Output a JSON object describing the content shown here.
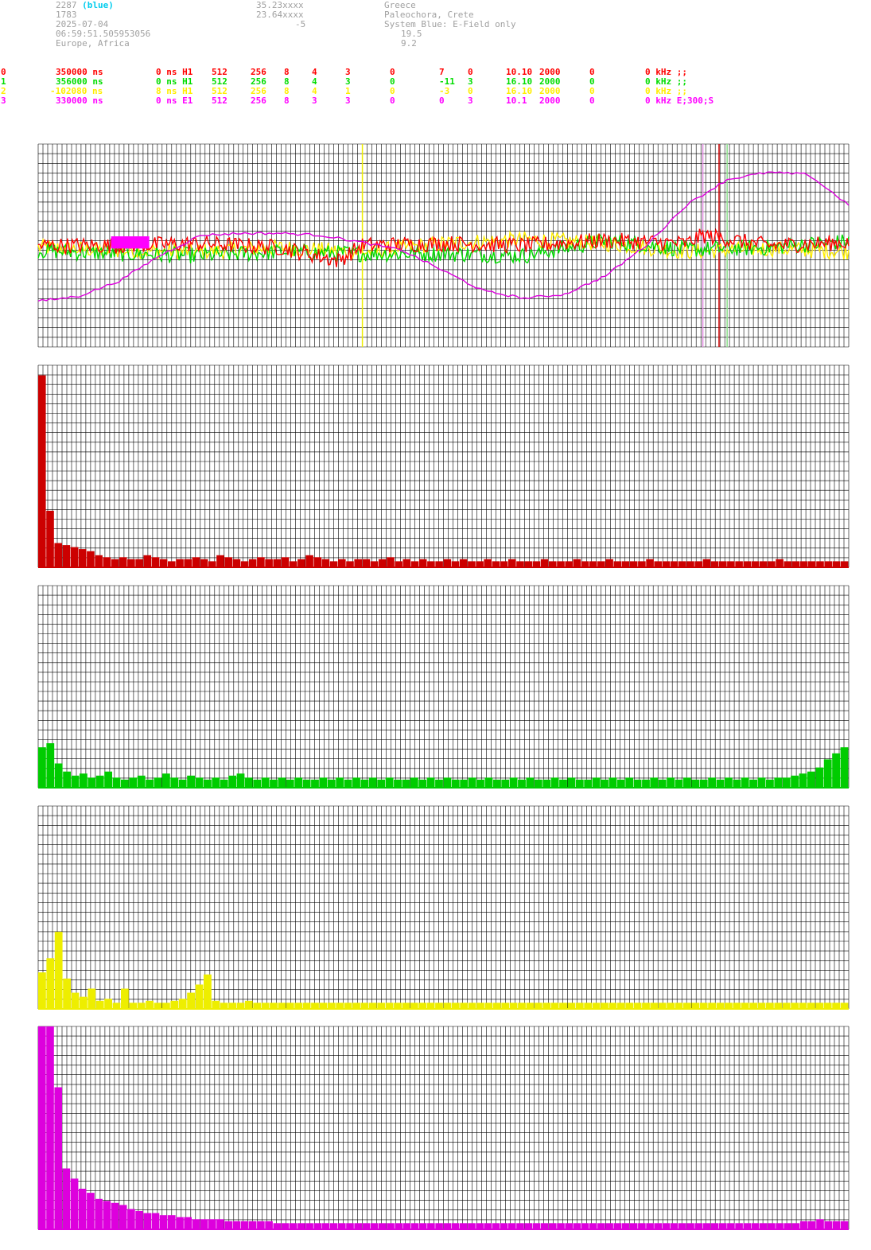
{
  "header": {
    "col1": [
      "2287",
      "1783",
      "2025-07-04",
      "06:59:51.505953056",
      "Europe, Africa"
    ],
    "col1_tag": "(blue)",
    "col2": [
      "35.23xxxx",
      "23.64xxxx",
      "-5"
    ],
    "col3": [
      "Greece",
      "Paleochora, Crete",
      "System Blue: E-Field only",
      "19.5",
      "9.2"
    ]
  },
  "channels": [
    {
      "id": "0",
      "color": "#ff0000",
      "cells": [
        "350000 ns",
        "0 ns H1",
        "512",
        "256",
        "8",
        "4",
        "3",
        "0",
        "7",
        "0",
        "10.10",
        "2000",
        "0",
        "0 kHz ;;"
      ]
    },
    {
      "id": "1",
      "color": "#00dd00",
      "cells": [
        "356000 ns",
        "0 ns H1",
        "512",
        "256",
        "8",
        "4",
        "3",
        "0",
        "-11",
        "3",
        "16.10",
        "2000",
        "0",
        "0 kHz ;;"
      ]
    },
    {
      "id": "2",
      "color": "#ffee00",
      "cells": [
        "-102080 ns",
        "8 ns H1",
        "512",
        "256",
        "8",
        "4",
        "1",
        "0",
        "-3",
        "0",
        "16.10",
        "2000",
        "0",
        "0 kHz ;;"
      ]
    },
    {
      "id": "3",
      "color": "#ff00ff",
      "cells": [
        "330000 ns",
        "0 ns E1",
        "512",
        "256",
        "8",
        "3",
        "3",
        "0",
        "0",
        "3",
        "10.1",
        "2000",
        "0",
        "0 kHz E;300;S"
      ]
    }
  ],
  "colors": {
    "grid": "#000000",
    "bg": "#ffffff",
    "red": "#cc0000",
    "green": "#00cc00",
    "yellow": "#eeee00",
    "magenta": "#dd00dd"
  },
  "chart_data": [
    {
      "type": "line",
      "panel": "waveform",
      "series": [
        {
          "color": "#dd00dd",
          "x": [
            0,
            5,
            10,
            15,
            20,
            25,
            30,
            35,
            40,
            45,
            50,
            55,
            60,
            65,
            70,
            75,
            80,
            85,
            90,
            95,
            100
          ],
          "y": [
            -5.5,
            -5.0,
            -3.5,
            -1.0,
            1.0,
            1.2,
            1.2,
            1.0,
            0.3,
            -0.5,
            -2.5,
            -4.5,
            -5.2,
            -4.8,
            -3.0,
            0.0,
            4.0,
            6.5,
            7.2,
            7.0,
            4.0
          ]
        },
        {
          "color": "#ff0000",
          "x": [
            0,
            10,
            20,
            30,
            37,
            40,
            50,
            60,
            70,
            80,
            82,
            90,
            100
          ],
          "y": [
            0,
            0,
            0.2,
            -0.2,
            -1.5,
            0,
            0.2,
            0,
            0.5,
            0.2,
            1.0,
            0,
            0.3
          ]
        },
        {
          "color": "#00dd00",
          "x": [
            0,
            10,
            20,
            30,
            40,
            50,
            60,
            70,
            80,
            90,
            100
          ],
          "y": [
            -0.5,
            -0.8,
            -1.0,
            -0.6,
            -0.8,
            -0.8,
            -1.0,
            0.5,
            -0.4,
            -0.2,
            0.4
          ]
        },
        {
          "color": "#ffee00",
          "x": [
            0,
            10,
            20,
            30,
            40,
            50,
            60,
            70,
            80,
            90,
            100
          ],
          "y": [
            -0.2,
            -0.5,
            -0.6,
            -0.2,
            -0.7,
            0.2,
            0.6,
            0.2,
            -0.6,
            -0.3,
            -0.6
          ]
        }
      ],
      "ylim": [
        -10,
        10
      ],
      "markers": [
        {
          "x": 40,
          "color": "#eeee00"
        },
        {
          "x": 82,
          "color": "#dd88dd"
        },
        {
          "x": 84,
          "color": "#cc0000"
        },
        {
          "x": 85,
          "color": "#88dd88"
        }
      ],
      "grid": true
    },
    {
      "type": "bar",
      "panel": "spectrum-0",
      "color": "#cc0000",
      "ylim": [
        0,
        100
      ],
      "values": [
        95,
        28,
        12,
        11,
        10,
        9,
        8,
        6,
        5,
        4,
        5,
        4,
        4,
        6,
        5,
        4,
        3,
        4,
        4,
        5,
        4,
        3,
        6,
        5,
        4,
        3,
        4,
        5,
        4,
        4,
        5,
        3,
        4,
        6,
        5,
        4,
        3,
        4,
        3,
        4,
        4,
        3,
        4,
        5,
        3,
        4,
        3,
        4,
        3,
        3,
        4,
        3,
        4,
        3,
        3,
        4,
        3,
        3,
        4,
        3,
        3,
        3,
        4,
        3,
        3,
        3,
        4,
        3,
        3,
        3,
        4,
        3,
        3,
        3,
        3,
        4,
        3,
        3,
        3,
        3,
        3,
        3,
        4,
        3,
        3,
        3,
        3,
        3,
        3,
        3,
        3,
        4,
        3,
        3,
        3,
        3,
        3,
        3,
        3,
        3
      ]
    },
    {
      "type": "bar",
      "panel": "spectrum-1",
      "color": "#00cc00",
      "ylim": [
        0,
        100
      ],
      "values": [
        20,
        22,
        12,
        8,
        6,
        7,
        5,
        6,
        8,
        5,
        4,
        5,
        6,
        4,
        5,
        7,
        5,
        4,
        6,
        5,
        4,
        5,
        4,
        6,
        7,
        5,
        4,
        5,
        4,
        5,
        4,
        5,
        4,
        4,
        5,
        4,
        5,
        4,
        5,
        4,
        5,
        4,
        5,
        4,
        4,
        5,
        4,
        5,
        4,
        5,
        4,
        4,
        5,
        4,
        5,
        4,
        4,
        5,
        4,
        5,
        4,
        4,
        5,
        4,
        5,
        4,
        4,
        5,
        4,
        5,
        4,
        5,
        4,
        4,
        5,
        4,
        5,
        4,
        5,
        4,
        4,
        5,
        4,
        5,
        4,
        5,
        4,
        5,
        4,
        5,
        5,
        6,
        7,
        8,
        10,
        14,
        17,
        20
      ]
    },
    {
      "type": "bar",
      "panel": "spectrum-2",
      "color": "#eeee00",
      "ylim": [
        0,
        100
      ],
      "values": [
        18,
        25,
        38,
        15,
        8,
        6,
        10,
        4,
        5,
        3,
        10,
        3,
        3,
        4,
        3,
        3,
        4,
        5,
        8,
        12,
        17,
        4,
        3,
        3,
        3,
        4,
        3,
        3,
        3,
        3,
        3,
        3,
        3,
        3,
        3,
        3,
        3,
        3,
        3,
        3,
        3,
        3,
        3,
        3,
        3,
        3,
        3,
        3,
        3,
        3,
        3,
        3,
        3,
        3,
        3,
        3,
        3,
        3,
        3,
        3,
        3,
        3,
        3,
        3,
        3,
        3,
        3,
        3,
        3,
        3,
        3,
        3,
        3,
        3,
        3,
        3,
        3,
        3,
        3,
        3,
        3,
        3,
        3,
        3,
        3,
        3,
        3,
        3,
        3,
        3,
        3,
        3,
        3,
        3,
        3,
        3,
        3,
        3
      ]
    },
    {
      "type": "bar",
      "panel": "spectrum-3",
      "color": "#dd00dd",
      "ylim": [
        0,
        100
      ],
      "values": [
        100,
        100,
        70,
        30,
        25,
        20,
        18,
        15,
        14,
        13,
        12,
        10,
        9,
        8,
        8,
        7,
        7,
        6,
        6,
        5,
        5,
        5,
        5,
        4,
        4,
        4,
        4,
        4,
        4,
        3,
        3,
        3,
        3,
        3,
        3,
        3,
        3,
        3,
        3,
        3,
        3,
        3,
        3,
        3,
        3,
        3,
        3,
        3,
        3,
        3,
        3,
        3,
        3,
        3,
        3,
        3,
        3,
        3,
        3,
        3,
        3,
        3,
        3,
        3,
        3,
        3,
        3,
        3,
        3,
        3,
        3,
        3,
        3,
        3,
        3,
        3,
        3,
        3,
        3,
        3,
        3,
        3,
        3,
        3,
        3,
        3,
        3,
        3,
        3,
        3,
        3,
        3,
        3,
        3,
        4,
        4,
        5,
        4,
        4,
        4
      ]
    }
  ]
}
